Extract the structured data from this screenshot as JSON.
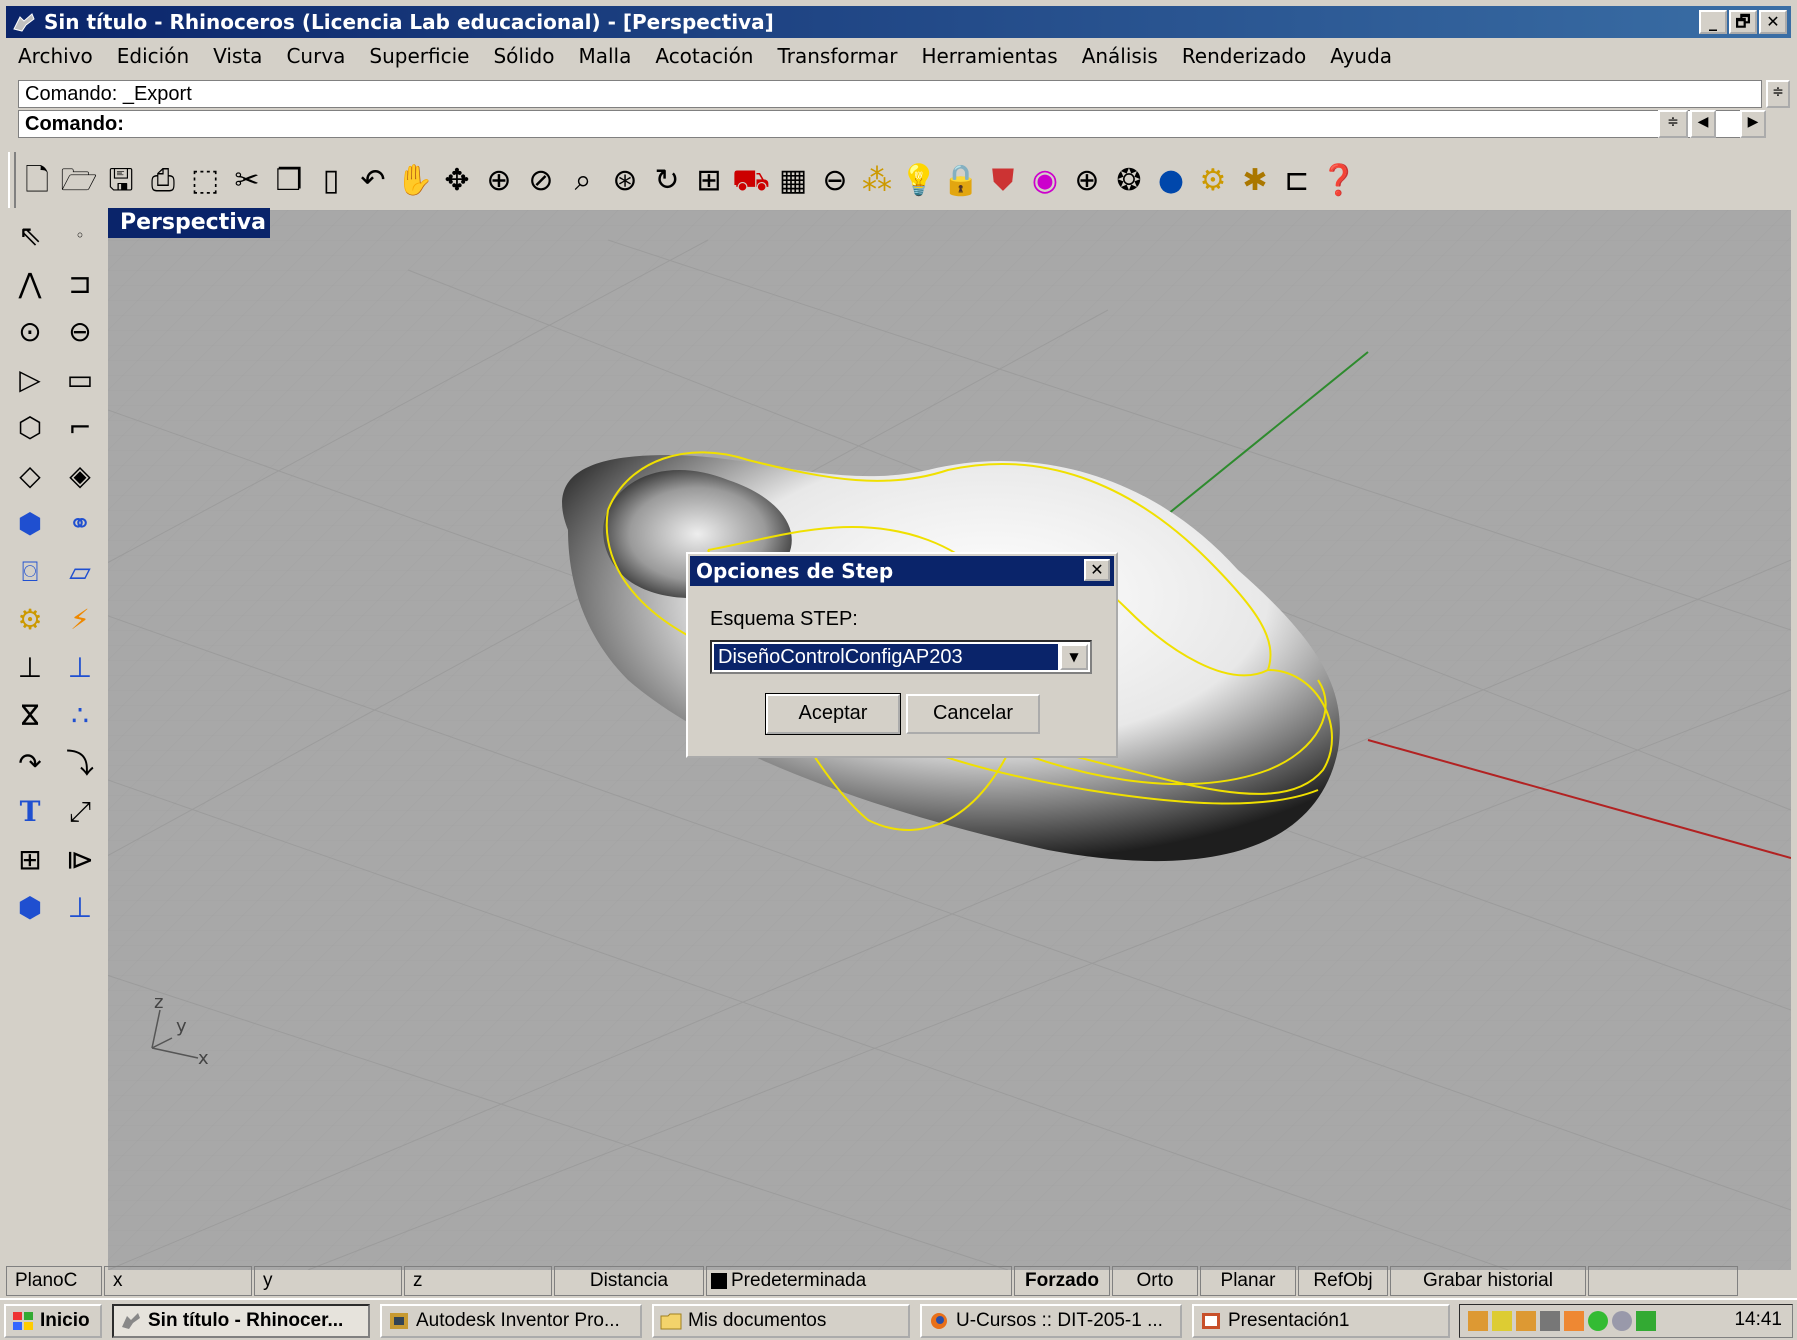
{
  "window": {
    "title": "Sin título - Rhinoceros (Licencia Lab educacional) - [Perspectiva]",
    "buttons": [
      "_",
      "🗗",
      "✕"
    ]
  },
  "menu": [
    "Archivo",
    "Edición",
    "Vista",
    "Curva",
    "Superficie",
    "Sólido",
    "Malla",
    "Acotación",
    "Transformar",
    "Herramientas",
    "Análisis",
    "Renderizado",
    "Ayuda"
  ],
  "command": {
    "history": "Comando: _Export",
    "prompt": "Comando:"
  },
  "toolbar_icons": [
    "new-icon",
    "open-icon",
    "save-icon",
    "print-icon",
    "import-icon",
    "cut-icon",
    "copy-icon",
    "paste-icon",
    "undo-icon",
    "pan-hand-icon",
    "rotate-view-icon",
    "zoom-dynamic-icon",
    "zoom-window-icon",
    "zoom-extents-icon",
    "zoom-selected-icon",
    "rotate-camera-icon",
    "viewports-icon",
    "car-icon",
    "grid-plane-icon",
    "osnap-icon",
    "layer-points-icon",
    "light-icon",
    "lock-icon",
    "shade-icon",
    "color-wheel-icon",
    "sphere-wire-icon",
    "render-globe-icon",
    "blue-sphere-icon",
    "tools-gear-icon",
    "settings-icon",
    "layout-icon",
    "help-icon"
  ],
  "viewport": {
    "title": "Perspectiva",
    "axis_labels": {
      "z": "z",
      "y": "y",
      "x": "x"
    }
  },
  "dialog": {
    "title": "Opciones de Step",
    "label": "Esquema STEP:",
    "selected": "DiseñoControlConfigAP203",
    "ok": "Aceptar",
    "cancel": "Cancelar"
  },
  "status": {
    "plane": "PlanoC",
    "x": "x",
    "y": "y",
    "z": "z",
    "distance": "Distancia",
    "layer": "Predeterminada",
    "snap": "Forzado",
    "ortho": "Orto",
    "planar": "Planar",
    "osnap": "RefObj",
    "history": "Grabar historial"
  },
  "taskbar": {
    "start": "Inicio",
    "tasks": [
      "Sin título - Rhinocer...",
      "Autodesk Inventor Pro...",
      "Mis documentos",
      "U-Cursos :: DIT-205-1 ...",
      "Presentación1"
    ],
    "clock": "14:41"
  }
}
